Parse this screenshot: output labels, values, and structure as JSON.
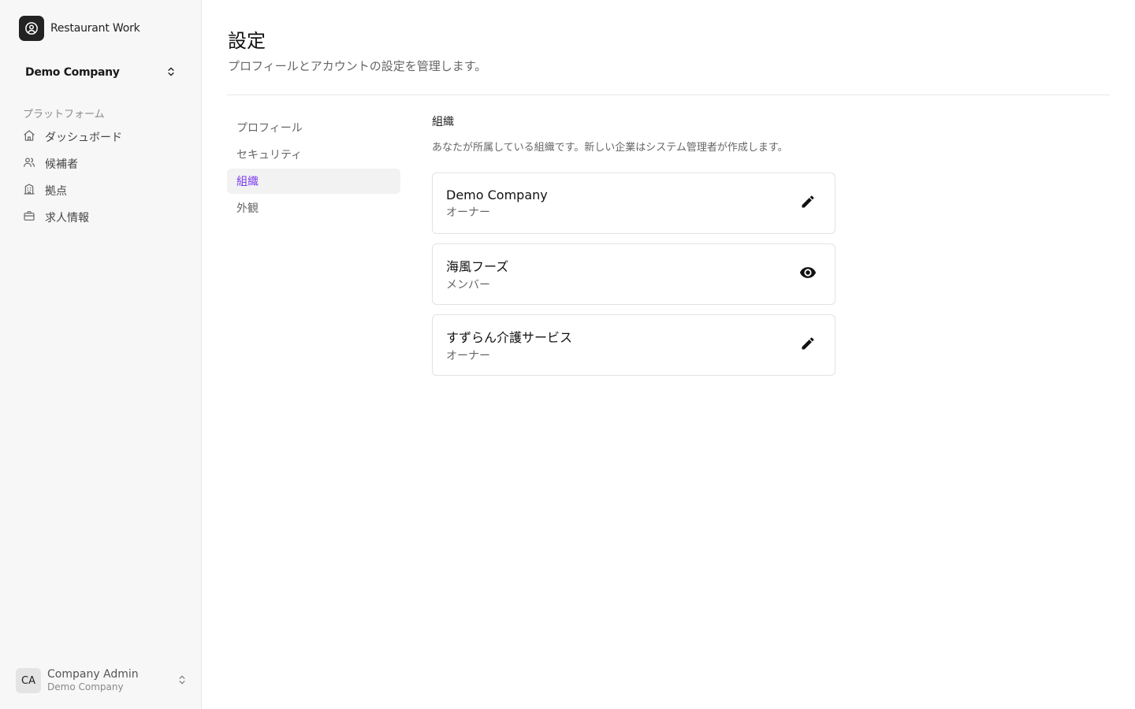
{
  "brand": {
    "name": "Restaurant Work",
    "icon": "user-circle-icon"
  },
  "company_switcher": {
    "label": "Demo Company",
    "icon": "chevron-up-down-icon"
  },
  "sidebar": {
    "section_title": "プラットフォーム",
    "items": [
      {
        "label": "ダッシュボード",
        "icon": "home-icon"
      },
      {
        "label": "候補者",
        "icon": "users-icon"
      },
      {
        "label": "拠点",
        "icon": "building-icon"
      },
      {
        "label": "求人情報",
        "icon": "briefcase-icon"
      }
    ]
  },
  "user": {
    "initials": "CA",
    "name": "Company Admin",
    "company": "Demo Company",
    "icon": "chevron-up-down-icon"
  },
  "page": {
    "title": "設定",
    "subtitle": "プロフィールとアカウントの設定を管理します。"
  },
  "settings_nav": {
    "items": [
      {
        "label": "プロフィール",
        "active": false
      },
      {
        "label": "セキュリティ",
        "active": false
      },
      {
        "label": "組織",
        "active": true
      },
      {
        "label": "外観",
        "active": false
      }
    ]
  },
  "organizations": {
    "title": "組織",
    "description": "あなたが所属している組織です。新しい企業はシステム管理者が作成します。",
    "items": [
      {
        "name": "Demo Company",
        "role": "オーナー",
        "action_icon": "pencil-icon"
      },
      {
        "name": "海風フーズ",
        "role": "メンバー",
        "action_icon": "eye-icon"
      },
      {
        "name": "すずらん介護サービス",
        "role": "オーナー",
        "action_icon": "pencil-icon"
      }
    ]
  },
  "colors": {
    "accent": "#7c3aed",
    "sidebar_bg": "#f7f7f7",
    "logo_bg": "#232323"
  }
}
